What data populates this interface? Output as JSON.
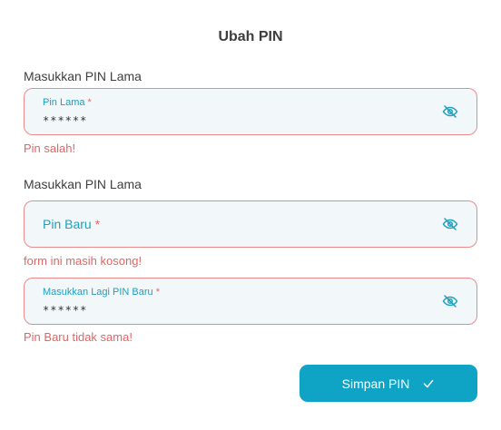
{
  "page": {
    "title": "Ubah PIN"
  },
  "sections": [
    {
      "heading": "Masukkan PIN Lama",
      "field": {
        "label": "Pin Lama",
        "required_mark": "*",
        "value": "******",
        "icon": "eye-off-icon"
      },
      "error": "Pin salah!"
    },
    {
      "heading": "Masukkan PIN Lama",
      "field": {
        "label": "Pin Baru",
        "required_mark": "*",
        "value": "",
        "icon": "eye-off-icon"
      },
      "error": "form ini masih kosong!"
    },
    {
      "heading": "",
      "field": {
        "label": "Masukkan Lagi PIN Baru",
        "required_mark": "*",
        "value": "******",
        "icon": "eye-off-icon"
      },
      "error": "Pin Baru tidak sama!"
    }
  ],
  "submit": {
    "label": "Simpan PIN",
    "icon": "check-icon"
  },
  "colors": {
    "accent": "#0fa3c5",
    "label": "#1d9fbf",
    "error": "#e06666",
    "error_border": "#e98b8b",
    "field_bg": "#f2f7fa"
  }
}
